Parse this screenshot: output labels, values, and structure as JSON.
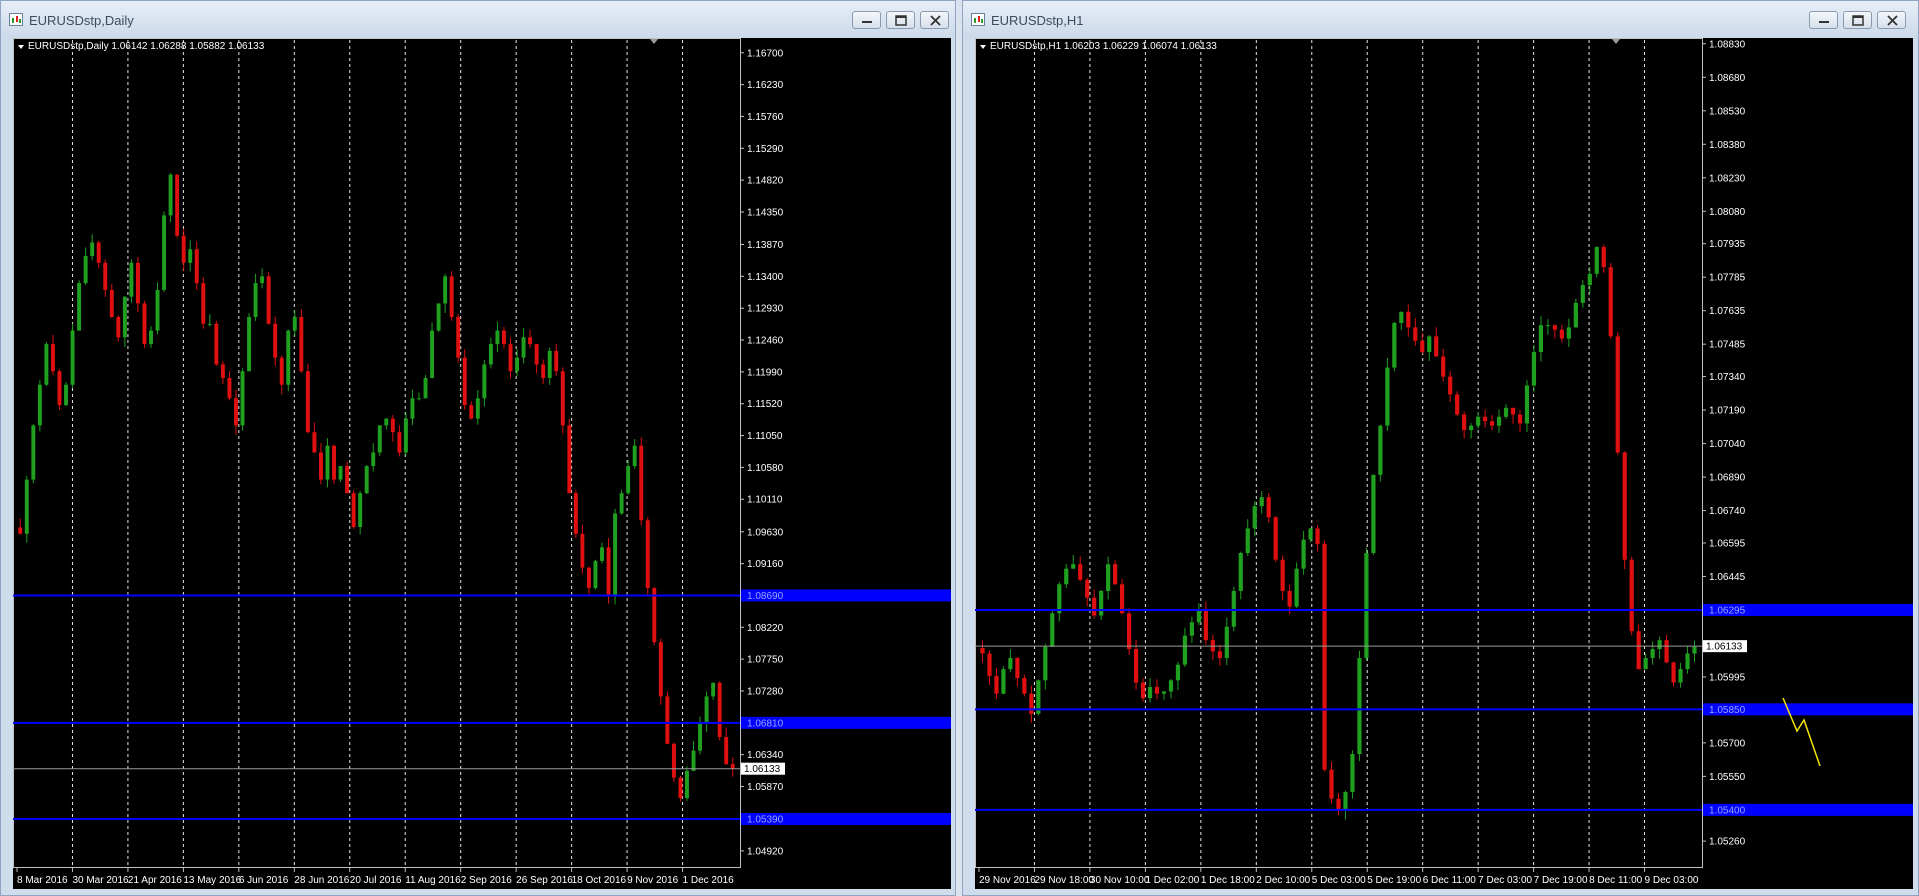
{
  "windows": [
    {
      "id": "left",
      "title": "EURUSDstp,Daily",
      "chart_data": {
        "type": "candlestick",
        "symbol_line": "EURUSDstp,Daily  1.06142 1.06288 1.05882 1.06133",
        "ylim": [
          1.048,
          1.168
        ],
        "y_ticks": [
          "1.16700",
          "1.16230",
          "1.15760",
          "1.15290",
          "1.14820",
          "1.14350",
          "1.13870",
          "1.13400",
          "1.12930",
          "1.12460",
          "1.11990",
          "1.11520",
          "1.11050",
          "1.10580",
          "1.10110",
          "1.09630",
          "1.09160",
          "1.08690",
          "1.08220",
          "1.07750",
          "1.07280",
          "1.06810",
          "1.06340",
          "1.06133",
          "1.05870",
          "1.05390",
          "1.04920"
        ],
        "x_ticks": [
          "8 Mar 2016",
          "30 Mar 2016",
          "21 Apr 2016",
          "13 May 2016",
          "6 Jun 2016",
          "28 Jun 2016",
          "20 Jul 2016",
          "11 Aug 2016",
          "2 Sep 2016",
          "26 Sep 2016",
          "18 Oct 2016",
          "9 Nov 2016",
          "1 Dec 2016"
        ],
        "current_price": "1.06133",
        "horizontal_lines": [
          {
            "price": 1.0869,
            "label": "1.08690",
            "color": "#0000ff"
          },
          {
            "price": 1.0681,
            "label": "1.06810",
            "color": "#0000ff"
          },
          {
            "price": 1.0539,
            "label": "1.05390",
            "color": "#0000ff"
          }
        ],
        "closes": [
          1.096,
          1.104,
          1.112,
          1.118,
          1.124,
          1.12,
          1.115,
          1.118,
          1.126,
          1.133,
          1.137,
          1.139,
          1.136,
          1.132,
          1.128,
          1.125,
          1.131,
          1.136,
          1.13,
          1.124,
          1.126,
          1.132,
          1.143,
          1.149,
          1.14,
          1.136,
          1.138,
          1.133,
          1.127,
          1.127,
          1.121,
          1.119,
          1.116,
          1.112,
          1.12,
          1.128,
          1.133,
          1.134,
          1.127,
          1.122,
          1.118,
          1.126,
          1.128,
          1.12,
          1.111,
          1.108,
          1.104,
          1.109,
          1.104,
          1.106,
          1.102,
          1.097,
          1.102,
          1.106,
          1.108,
          1.112,
          1.113,
          1.111,
          1.108,
          1.113,
          1.116,
          1.116,
          1.119,
          1.126,
          1.13,
          1.134,
          1.128,
          1.122,
          1.115,
          1.113,
          1.116,
          1.121,
          1.124,
          1.126,
          1.124,
          1.12,
          1.122,
          1.125,
          1.124,
          1.121,
          1.119,
          1.123,
          1.12,
          1.112,
          1.102,
          1.096,
          1.091,
          1.088,
          1.092,
          1.094,
          1.087,
          1.099,
          1.102,
          1.106,
          1.109,
          1.098,
          1.088,
          1.08,
          1.072,
          1.065,
          1.06,
          1.057,
          1.061,
          1.064,
          1.068,
          1.072,
          1.074,
          1.066,
          1.062,
          1.0613
        ]
      }
    },
    {
      "id": "right",
      "title": "EURUSDstp,H1",
      "chart_data": {
        "type": "candlestick",
        "symbol_line": "EURUSDstp,H1  1.06203 1.06229 1.06074 1.06133",
        "ylim": [
          1.0518,
          1.0882
        ],
        "y_ticks": [
          "1.08830",
          "1.08680",
          "1.08530",
          "1.08380",
          "1.08230",
          "1.08080",
          "1.07935",
          "1.07785",
          "1.07635",
          "1.07485",
          "1.07340",
          "1.07190",
          "1.07040",
          "1.06890",
          "1.06740",
          "1.06595",
          "1.06445",
          "1.06295",
          "1.06133",
          "1.05995",
          "1.05850",
          "1.05700",
          "1.05550",
          "1.05400",
          "1.05260"
        ],
        "x_ticks": [
          "29 Nov 2016",
          "29 Nov 18:00",
          "30 Nov 10:00",
          "1 Dec 02:00",
          "1 Dec 18:00",
          "2 Dec 10:00",
          "5 Dec 03:00",
          "5 Dec 19:00",
          "6 Dec 11:00",
          "7 Dec 03:00",
          "7 Dec 19:00",
          "8 Dec 11:00",
          "9 Dec 03:00"
        ],
        "current_price": "1.06133",
        "horizontal_lines": [
          {
            "price": 1.06295,
            "label": "1.06295",
            "color": "#0000ff"
          },
          {
            "price": 1.0585,
            "label": "1.05850",
            "color": "#0000ff"
          },
          {
            "price": 1.054,
            "label": "1.05400",
            "color": "#0000ff"
          }
        ],
        "closes": [
          1.061,
          1.06,
          1.0592,
          1.0603,
          1.0608,
          1.0599,
          1.0592,
          1.0583,
          1.0598,
          1.0613,
          1.0628,
          1.0641,
          1.0648,
          1.065,
          1.0643,
          1.0635,
          1.0627,
          1.0638,
          1.065,
          1.0641,
          1.0628,
          1.0612,
          1.0597,
          1.059,
          1.0595,
          1.0592,
          1.0593,
          1.0598,
          1.0605,
          1.0618,
          1.0624,
          1.0629,
          1.0616,
          1.0611,
          1.0608,
          1.0622,
          1.0638,
          1.0655,
          1.0666,
          1.0676,
          1.068,
          1.0671,
          1.0652,
          1.0638,
          1.0631,
          1.0648,
          1.0661,
          1.0666,
          1.0659,
          1.0558,
          1.0545,
          1.054,
          1.0548,
          1.0565,
          1.0608,
          1.0655,
          1.069,
          1.0712,
          1.0738,
          1.0758,
          1.0763,
          1.0756,
          1.075,
          1.0745,
          1.0752,
          1.0743,
          1.0734,
          1.0726,
          1.0717,
          1.071,
          1.0712,
          1.0716,
          1.0714,
          1.0712,
          1.0716,
          1.072,
          1.0717,
          1.0713,
          1.073,
          1.0745,
          1.0757,
          1.0757,
          1.0755,
          1.0751,
          1.0756,
          1.0767,
          1.0775,
          1.078,
          1.0792,
          1.0783,
          1.0752,
          1.07,
          1.0652,
          1.062,
          1.0603,
          1.0608,
          1.0612,
          1.0616,
          1.0606,
          1.0597,
          1.0603,
          1.061,
          1.0613
        ],
        "annotation": "yellow-zigzag"
      }
    }
  ]
}
